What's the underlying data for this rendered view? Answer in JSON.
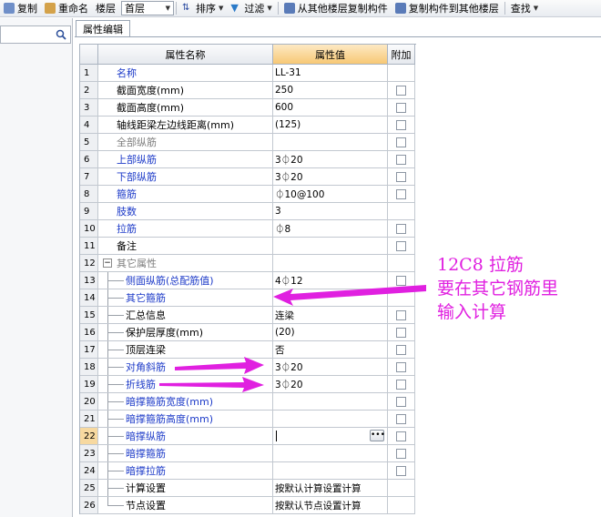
{
  "toolbar": {
    "copy_label": "复制",
    "rename_label": "重命名",
    "floor_label": "楼层",
    "floor_value": "首层",
    "sort_label": "排序",
    "filter_label": "过滤",
    "copy_from_other_label": "从其他楼层复制构件",
    "copy_to_other_label": "复制构件到其他楼层",
    "find_label": "查找"
  },
  "tab": {
    "label": "属性编辑"
  },
  "grid": {
    "headers": {
      "name": "属性名称",
      "value": "属性值",
      "add": "附加"
    },
    "rows": [
      {
        "num": "1",
        "name": "名称",
        "value": "LL-31",
        "style": "blue",
        "indent": 0,
        "checkbox": false
      },
      {
        "num": "2",
        "name": "截面宽度(mm)",
        "value": "250",
        "style": "normal",
        "indent": 0,
        "checkbox": true
      },
      {
        "num": "3",
        "name": "截面高度(mm)",
        "value": "600",
        "style": "normal",
        "indent": 0,
        "checkbox": true
      },
      {
        "num": "4",
        "name": "轴线距梁左边线距离(mm)",
        "value": "(125)",
        "style": "normal",
        "indent": 0,
        "checkbox": true
      },
      {
        "num": "5",
        "name": "全部纵筋",
        "value": "",
        "style": "gray",
        "indent": 0,
        "checkbox": true
      },
      {
        "num": "6",
        "name": "上部纵筋",
        "value": "3⏀20",
        "style": "blue",
        "indent": 0,
        "checkbox": true
      },
      {
        "num": "7",
        "name": "下部纵筋",
        "value": "3⏀20",
        "style": "blue",
        "indent": 0,
        "checkbox": true
      },
      {
        "num": "8",
        "name": "箍筋",
        "value": "⏀10@100",
        "style": "blue",
        "indent": 0,
        "checkbox": true
      },
      {
        "num": "9",
        "name": "肢数",
        "value": "3",
        "style": "blue",
        "indent": 0,
        "checkbox": false
      },
      {
        "num": "10",
        "name": "拉筋",
        "value": "⏀8",
        "style": "blue",
        "indent": 0,
        "checkbox": true
      },
      {
        "num": "11",
        "name": "备注",
        "value": "",
        "style": "normal",
        "indent": 0,
        "checkbox": true
      },
      {
        "num": "12",
        "name": "其它属性",
        "value": "",
        "style": "gray",
        "indent": -1,
        "checkbox": false,
        "group": true
      },
      {
        "num": "13",
        "name": "侧面纵筋(总配筋值)",
        "value": "4⏀12",
        "style": "blue",
        "indent": 1,
        "checkbox": true
      },
      {
        "num": "14",
        "name": "其它箍筋",
        "value": "",
        "style": "blue",
        "indent": 1,
        "checkbox": false
      },
      {
        "num": "15",
        "name": "汇总信息",
        "value": "连梁",
        "style": "normal",
        "indent": 1,
        "checkbox": true
      },
      {
        "num": "16",
        "name": "保护层厚度(mm)",
        "value": "(20)",
        "style": "normal",
        "indent": 1,
        "checkbox": true
      },
      {
        "num": "17",
        "name": "顶层连梁",
        "value": "否",
        "style": "normal",
        "indent": 1,
        "checkbox": true
      },
      {
        "num": "18",
        "name": "对角斜筋",
        "value": "3⏀20",
        "style": "blue",
        "indent": 1,
        "checkbox": true
      },
      {
        "num": "19",
        "name": "折线筋",
        "value": "3⏀20",
        "style": "blue",
        "indent": 1,
        "checkbox": true
      },
      {
        "num": "20",
        "name": "暗撑箍筋宽度(mm)",
        "value": "",
        "style": "blue",
        "indent": 1,
        "checkbox": true
      },
      {
        "num": "21",
        "name": "暗撑箍筋高度(mm)",
        "value": "",
        "style": "blue",
        "indent": 1,
        "checkbox": true
      },
      {
        "num": "22",
        "name": "暗撑纵筋",
        "value": "",
        "style": "blue",
        "indent": 1,
        "checkbox": true,
        "selected": true
      },
      {
        "num": "23",
        "name": "暗撑箍筋",
        "value": "",
        "style": "blue",
        "indent": 1,
        "checkbox": true
      },
      {
        "num": "24",
        "name": "暗撑拉筋",
        "value": "",
        "style": "blue",
        "indent": 1,
        "checkbox": true
      },
      {
        "num": "25",
        "name": "计算设置",
        "value": "按默认计算设置计算",
        "style": "normal",
        "indent": 1,
        "checkbox": false
      },
      {
        "num": "26",
        "name": "节点设置",
        "value": "按默认节点设置计算",
        "style": "normal",
        "indent": 1,
        "checkbox": false
      }
    ]
  },
  "annotation": {
    "line1": "12C8 拉筋",
    "line2": "要在其它钢筋里",
    "line3": "输入计算",
    "color": "#e020e0"
  },
  "icons": {
    "copy": "copy-icon",
    "rename": "rename-icon",
    "sort": "sort-icon",
    "filter": "filter-icon",
    "search": "search-icon"
  }
}
